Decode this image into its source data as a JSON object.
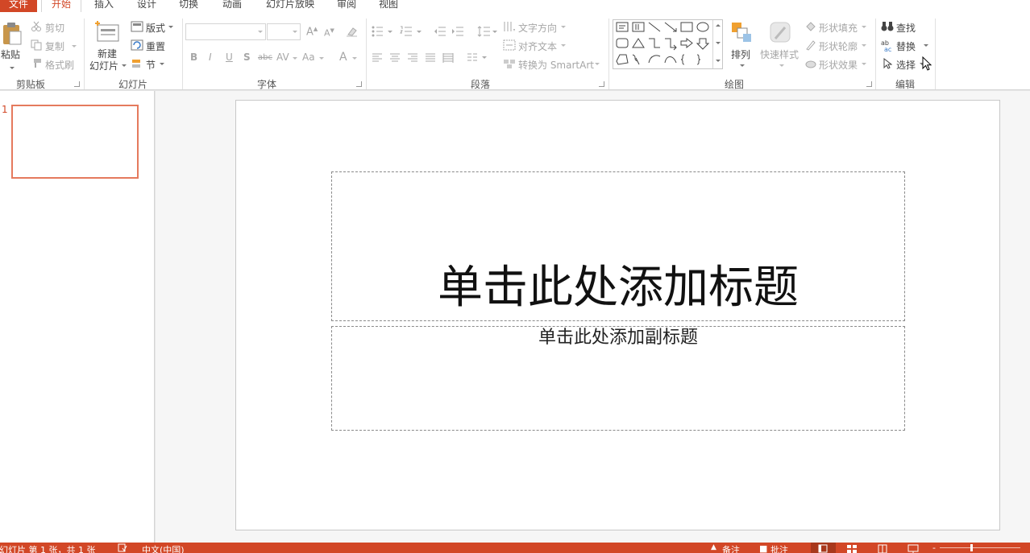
{
  "tabs": [
    "文件",
    "开始",
    "插入",
    "设计",
    "切换",
    "动画",
    "幻灯片放映",
    "审阅",
    "视图"
  ],
  "ribbon": {
    "clipboard": {
      "paste": "粘贴",
      "cut": "剪切",
      "copy": "复制",
      "format_painter": "格式刷",
      "label": "剪贴板"
    },
    "slides": {
      "new_slide_1": "新建",
      "new_slide_2": "幻灯片",
      "layout": "版式",
      "reset": "重置",
      "section": "节",
      "label": "幻灯片"
    },
    "font": {
      "label": "字体",
      "bold": "B",
      "italic": "I",
      "underline": "U",
      "shadow": "S",
      "strike": "abc",
      "spacing": "AV",
      "case": "Aa",
      "color": "A"
    },
    "paragraph": {
      "text_direction": "文字方向",
      "align_text": "对齐文本",
      "smartart": "转换为 SmartArt",
      "label": "段落"
    },
    "drawing": {
      "arrange": "排列",
      "quick_styles": "快速样式",
      "fill": "形状填充",
      "outline": "形状轮廓",
      "effects": "形状效果",
      "label": "绘图"
    },
    "editing": {
      "find": "查找",
      "replace": "替换",
      "select": "选择",
      "label": "编辑"
    }
  },
  "thumbnails": {
    "number": "1"
  },
  "slide": {
    "title_placeholder": "单击此处添加标题",
    "subtitle_placeholder": "单击此处添加副标题"
  },
  "status": {
    "slide_info": "幻灯片 第 1 张，共 1 张",
    "language": "中文(中国)",
    "notes": "备注",
    "comments": "批注"
  },
  "colors": {
    "accent": "#d24726",
    "selection": "#e57a5d"
  }
}
